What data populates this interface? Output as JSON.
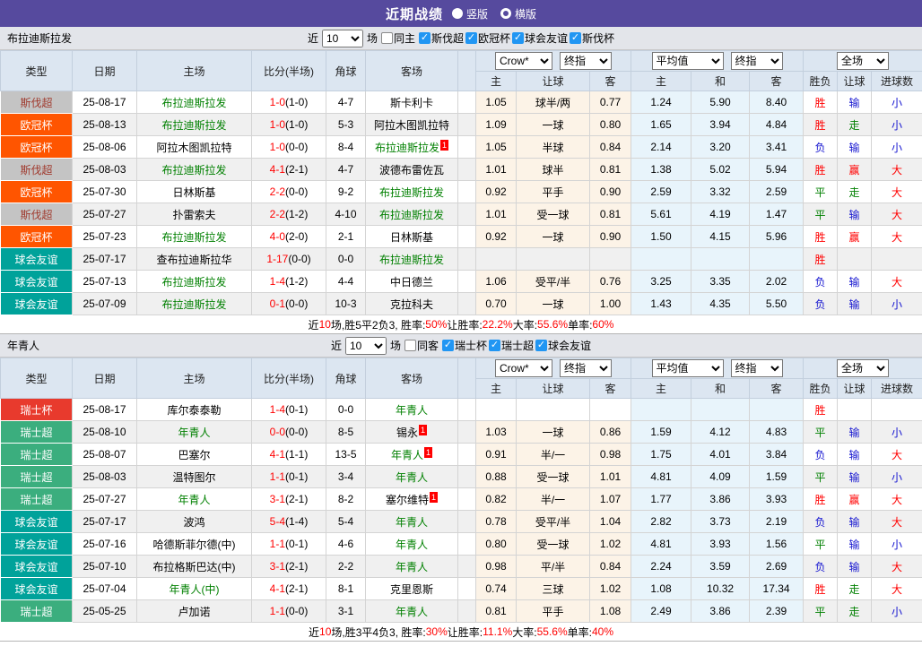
{
  "topbar": {
    "title": "近期战绩",
    "radios": [
      {
        "label": "竖版",
        "selected": true
      },
      {
        "label": "横版",
        "selected": false
      }
    ]
  },
  "colors": {
    "topbar_bg": "#564A9E",
    "header_bg": "#DCE6F1",
    "odds_bg": "#FCF3E7",
    "avg_bg": "#E8F4FB",
    "checkbox_blue": "#2196F3",
    "team_green": "#008000",
    "score_red": "#FF0000"
  },
  "league_colors": {
    "斯伐超": "silver",
    "欧冠杯": "orange",
    "球会友谊": "teal",
    "瑞士杯": "red",
    "瑞士超": "green",
    "斯伐杯": "silver"
  },
  "result_colors": {
    "胜": "red",
    "赢": "red",
    "大": "red",
    "平": "green",
    "走": "green",
    "负": "blue",
    "输": "blue",
    "小": "blue"
  },
  "table_header": {
    "type": "类型",
    "date": "日期",
    "home": "主场",
    "score": "比分(半场)",
    "corner": "角球",
    "away": "客场",
    "odds_source": "Crow*",
    "odds_stage": "终指",
    "avg_source": "平均值",
    "avg_stage": "终指",
    "scope": "全场",
    "odds_cols": [
      "主",
      "让球",
      "客"
    ],
    "avg_cols": [
      "主",
      "和",
      "客"
    ],
    "result_cols": [
      "胜负",
      "让球",
      "进球数"
    ]
  },
  "sections": [
    {
      "team": "布拉迪斯拉发",
      "filter": {
        "prefix": "近",
        "count": "10",
        "suffix": "场",
        "same_label": "同主",
        "same_checked": false,
        "leagues": [
          {
            "label": "斯伐超",
            "checked": true
          },
          {
            "label": "欧冠杯",
            "checked": true
          },
          {
            "label": "球会友谊",
            "checked": true
          },
          {
            "label": "斯伐杯",
            "checked": true
          }
        ]
      },
      "rows": [
        {
          "lg": "斯伐超",
          "d": "25-08-17",
          "h": "布拉迪斯拉发",
          "hg": 1,
          "hs": 0,
          "s": "1-0",
          "sh": "(1-0)",
          "c": "4-7",
          "a": "斯卡利卡",
          "ag": 0,
          "as": 0,
          "o1": "1.05",
          "o2": "球半/两",
          "o3": "0.77",
          "m1": "1.24",
          "m2": "5.90",
          "m3": "8.40",
          "r1": "胜",
          "r2": "输",
          "r3": "小"
        },
        {
          "lg": "欧冠杯",
          "d": "25-08-13",
          "h": "布拉迪斯拉发",
          "hg": 1,
          "hs": 0,
          "s": "1-0",
          "sh": "(1-0)",
          "c": "5-3",
          "a": "阿拉木图凯拉特",
          "ag": 0,
          "as": 0,
          "o1": "1.09",
          "o2": "一球",
          "o3": "0.80",
          "m1": "1.65",
          "m2": "3.94",
          "m3": "4.84",
          "r1": "胜",
          "r2": "走",
          "r3": "小"
        },
        {
          "lg": "欧冠杯",
          "d": "25-08-06",
          "h": "阿拉木图凯拉特",
          "hg": 0,
          "hs": 0,
          "s": "1-0",
          "sh": "(0-0)",
          "c": "8-4",
          "a": "布拉迪斯拉发",
          "ag": 1,
          "as": 1,
          "o1": "1.05",
          "o2": "半球",
          "o3": "0.84",
          "m1": "2.14",
          "m2": "3.20",
          "m3": "3.41",
          "r1": "负",
          "r2": "输",
          "r3": "小"
        },
        {
          "lg": "斯伐超",
          "d": "25-08-03",
          "h": "布拉迪斯拉发",
          "hg": 1,
          "hs": 0,
          "s": "4-1",
          "sh": "(2-1)",
          "c": "4-7",
          "a": "波德布雷佐瓦",
          "ag": 0,
          "as": 0,
          "o1": "1.01",
          "o2": "球半",
          "o3": "0.81",
          "m1": "1.38",
          "m2": "5.02",
          "m3": "5.94",
          "r1": "胜",
          "r2": "赢",
          "r3": "大"
        },
        {
          "lg": "欧冠杯",
          "d": "25-07-30",
          "h": "日林斯基",
          "hg": 0,
          "hs": 0,
          "s": "2-2",
          "sh": "(0-0)",
          "c": "9-2",
          "a": "布拉迪斯拉发",
          "ag": 1,
          "as": 0,
          "o1": "0.92",
          "o2": "平手",
          "o3": "0.90",
          "m1": "2.59",
          "m2": "3.32",
          "m3": "2.59",
          "r1": "平",
          "r2": "走",
          "r3": "大"
        },
        {
          "lg": "斯伐超",
          "d": "25-07-27",
          "h": "扑雷索夫",
          "hg": 0,
          "hs": 0,
          "s": "2-2",
          "sh": "(1-2)",
          "c": "4-10",
          "a": "布拉迪斯拉发",
          "ag": 1,
          "as": 0,
          "o1": "1.01",
          "o2": "受一球",
          "o3": "0.81",
          "m1": "5.61",
          "m2": "4.19",
          "m3": "1.47",
          "r1": "平",
          "r2": "输",
          "r3": "大"
        },
        {
          "lg": "欧冠杯",
          "d": "25-07-23",
          "h": "布拉迪斯拉发",
          "hg": 1,
          "hs": 0,
          "s": "4-0",
          "sh": "(2-0)",
          "c": "2-1",
          "a": "日林斯基",
          "ag": 0,
          "as": 0,
          "o1": "0.92",
          "o2": "一球",
          "o3": "0.90",
          "m1": "1.50",
          "m2": "4.15",
          "m3": "5.96",
          "r1": "胜",
          "r2": "赢",
          "r3": "大"
        },
        {
          "lg": "球会友谊",
          "d": "25-07-17",
          "h": "查布拉迪斯拉华",
          "hg": 0,
          "hs": 0,
          "s": "1-17",
          "sh": "(0-0)",
          "c": "0-0",
          "a": "布拉迪斯拉发",
          "ag": 1,
          "as": 0,
          "o1": "",
          "o2": "",
          "o3": "",
          "m1": "",
          "m2": "",
          "m3": "",
          "r1": "胜",
          "r2": "",
          "r3": ""
        },
        {
          "lg": "球会友谊",
          "d": "25-07-13",
          "h": "布拉迪斯拉发",
          "hg": 1,
          "hs": 0,
          "s": "1-4",
          "sh": "(1-2)",
          "c": "4-4",
          "a": "中日德兰",
          "ag": 0,
          "as": 0,
          "o1": "1.06",
          "o2": "受平/半",
          "o3": "0.76",
          "m1": "3.25",
          "m2": "3.35",
          "m3": "2.02",
          "r1": "负",
          "r2": "输",
          "r3": "大"
        },
        {
          "lg": "球会友谊",
          "d": "25-07-09",
          "h": "布拉迪斯拉发",
          "hg": 1,
          "hs": 0,
          "s": "0-1",
          "sh": "(0-0)",
          "c": "10-3",
          "a": "克拉科夫",
          "ag": 0,
          "as": 0,
          "o1": "0.70",
          "o2": "一球",
          "o3": "1.00",
          "m1": "1.43",
          "m2": "4.35",
          "m3": "5.50",
          "r1": "负",
          "r2": "输",
          "r3": "小"
        }
      ],
      "summary": [
        {
          "t": "近"
        },
        {
          "t": "10",
          "r": 1
        },
        {
          "t": "场,胜5平2负3, 胜率:"
        },
        {
          "t": "50%",
          "r": 1
        },
        {
          "t": " 让胜率:"
        },
        {
          "t": "22.2%",
          "r": 1
        },
        {
          "t": " 大率:"
        },
        {
          "t": "55.6%",
          "r": 1
        },
        {
          "t": " 单率:"
        },
        {
          "t": "60%",
          "r": 1
        }
      ]
    },
    {
      "team": "年青人",
      "filter": {
        "prefix": "近",
        "count": "10",
        "suffix": "场",
        "same_label": "同客",
        "same_checked": false,
        "leagues": [
          {
            "label": "瑞士杯",
            "checked": true
          },
          {
            "label": "瑞士超",
            "checked": true
          },
          {
            "label": "球会友谊",
            "checked": true
          }
        ]
      },
      "rows": [
        {
          "lg": "瑞士杯",
          "d": "25-08-17",
          "h": "库尔泰泰勒",
          "hg": 0,
          "hs": 0,
          "s": "1-4",
          "sh": "(0-1)",
          "c": "0-0",
          "a": "年青人",
          "ag": 1,
          "as": 0,
          "o1": "",
          "o2": "",
          "o3": "",
          "m1": "",
          "m2": "",
          "m3": "",
          "r1": "胜",
          "r2": "",
          "r3": ""
        },
        {
          "lg": "瑞士超",
          "d": "25-08-10",
          "h": "年青人",
          "hg": 1,
          "hs": 0,
          "s": "0-0",
          "sh": "(0-0)",
          "c": "8-5",
          "a": "锡永",
          "ag": 0,
          "as": 1,
          "o1": "1.03",
          "o2": "一球",
          "o3": "0.86",
          "m1": "1.59",
          "m2": "4.12",
          "m3": "4.83",
          "r1": "平",
          "r2": "输",
          "r3": "小"
        },
        {
          "lg": "瑞士超",
          "d": "25-08-07",
          "h": "巴塞尔",
          "hg": 0,
          "hs": 0,
          "s": "4-1",
          "sh": "(1-1)",
          "c": "13-5",
          "a": "年青人",
          "ag": 1,
          "as": 1,
          "o1": "0.91",
          "o2": "半/一",
          "o3": "0.98",
          "m1": "1.75",
          "m2": "4.01",
          "m3": "3.84",
          "r1": "负",
          "r2": "输",
          "r3": "大"
        },
        {
          "lg": "瑞士超",
          "d": "25-08-03",
          "h": "温特图尔",
          "hg": 0,
          "hs": 0,
          "s": "1-1",
          "sh": "(0-1)",
          "c": "3-4",
          "a": "年青人",
          "ag": 1,
          "as": 0,
          "o1": "0.88",
          "o2": "受一球",
          "o3": "1.01",
          "m1": "4.81",
          "m2": "4.09",
          "m3": "1.59",
          "r1": "平",
          "r2": "输",
          "r3": "小"
        },
        {
          "lg": "瑞士超",
          "d": "25-07-27",
          "h": "年青人",
          "hg": 1,
          "hs": 0,
          "s": "3-1",
          "sh": "(2-1)",
          "c": "8-2",
          "a": "塞尔维特",
          "ag": 0,
          "as": 1,
          "o1": "0.82",
          "o2": "半/一",
          "o3": "1.07",
          "m1": "1.77",
          "m2": "3.86",
          "m3": "3.93",
          "r1": "胜",
          "r2": "赢",
          "r3": "大"
        },
        {
          "lg": "球会友谊",
          "d": "25-07-17",
          "h": "波鸿",
          "hg": 0,
          "hs": 0,
          "s": "5-4",
          "sh": "(1-4)",
          "c": "5-4",
          "a": "年青人",
          "ag": 1,
          "as": 0,
          "o1": "0.78",
          "o2": "受平/半",
          "o3": "1.04",
          "m1": "2.82",
          "m2": "3.73",
          "m3": "2.19",
          "r1": "负",
          "r2": "输",
          "r3": "大"
        },
        {
          "lg": "球会友谊",
          "d": "25-07-16",
          "h": "哈德斯菲尔德(中)",
          "hg": 0,
          "hs": 0,
          "s": "1-1",
          "sh": "(0-1)",
          "c": "4-6",
          "a": "年青人",
          "ag": 1,
          "as": 0,
          "o1": "0.80",
          "o2": "受一球",
          "o3": "1.02",
          "m1": "4.81",
          "m2": "3.93",
          "m3": "1.56",
          "r1": "平",
          "r2": "输",
          "r3": "小"
        },
        {
          "lg": "球会友谊",
          "d": "25-07-10",
          "h": "布拉格斯巴达(中)",
          "hg": 0,
          "hs": 0,
          "s": "3-1",
          "sh": "(2-1)",
          "c": "2-2",
          "a": "年青人",
          "ag": 1,
          "as": 0,
          "o1": "0.98",
          "o2": "平/半",
          "o3": "0.84",
          "m1": "2.24",
          "m2": "3.59",
          "m3": "2.69",
          "r1": "负",
          "r2": "输",
          "r3": "大"
        },
        {
          "lg": "球会友谊",
          "d": "25-07-04",
          "h": "年青人(中)",
          "hg": 1,
          "hs": 0,
          "s": "4-1",
          "sh": "(2-1)",
          "c": "8-1",
          "a": "克里恩斯",
          "ag": 0,
          "as": 0,
          "o1": "0.74",
          "o2": "三球",
          "o3": "1.02",
          "m1": "1.08",
          "m2": "10.32",
          "m3": "17.34",
          "r1": "胜",
          "r2": "走",
          "r3": "大"
        },
        {
          "lg": "瑞士超",
          "d": "25-05-25",
          "h": "卢加诺",
          "hg": 0,
          "hs": 0,
          "s": "1-1",
          "sh": "(0-0)",
          "c": "3-1",
          "a": "年青人",
          "ag": 1,
          "as": 0,
          "o1": "0.81",
          "o2": "平手",
          "o3": "1.08",
          "m1": "2.49",
          "m2": "3.86",
          "m3": "2.39",
          "r1": "平",
          "r2": "走",
          "r3": "小"
        }
      ],
      "summary": [
        {
          "t": "近"
        },
        {
          "t": "10",
          "r": 1
        },
        {
          "t": "场,胜3平4负3, 胜率:"
        },
        {
          "t": "30%",
          "r": 1
        },
        {
          "t": " 让胜率:"
        },
        {
          "t": "11.1%",
          "r": 1
        },
        {
          "t": " 大率:"
        },
        {
          "t": "55.6%",
          "r": 1
        },
        {
          "t": " 单率:"
        },
        {
          "t": "40%",
          "r": 1
        }
      ]
    }
  ]
}
